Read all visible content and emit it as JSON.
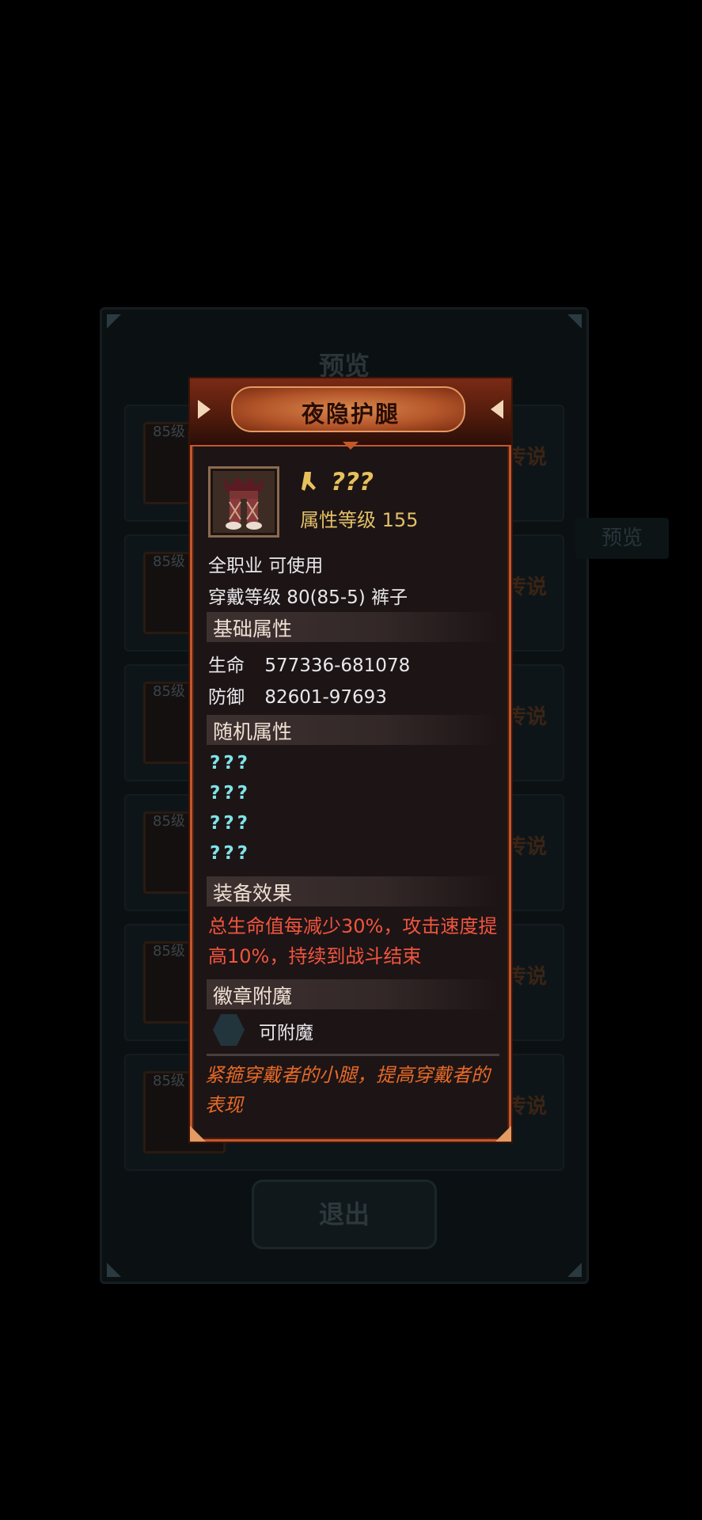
{
  "background": {
    "title": "预览",
    "rows": [
      {
        "level": "85级",
        "tag": "传说"
      },
      {
        "level": "85级",
        "tag": "传说"
      },
      {
        "level": "85级",
        "tag": "传说"
      },
      {
        "level": "85级",
        "tag": "传说"
      },
      {
        "level": "85级",
        "tag": "传说"
      },
      {
        "level": "85级",
        "tag": "传说"
      }
    ],
    "preview_button": "预览",
    "exit_button": "退出"
  },
  "item": {
    "title": "夜隐护腿",
    "name": "???",
    "attr_level": "属性等级 155",
    "class_req": "全职业 可使用",
    "wear_req": "穿戴等级 80(85-5) 裤子",
    "sections": {
      "base": "基础属性",
      "random": "随机属性",
      "effect": "装备效果",
      "badge": "徽章附魔"
    },
    "base_stats": [
      {
        "name": "生命",
        "value": "577336-681078"
      },
      {
        "name": "防御",
        "value": "82601-97693"
      }
    ],
    "random_stats": [
      "???",
      "???",
      "???",
      "???"
    ],
    "effect_text": "总生命值每减少30%，攻击速度提高10%，持续到战斗结束",
    "enchant_label": "可附魔",
    "description": "紧箍穿戴者的小腿，提高穿戴者的表现"
  },
  "colors": {
    "title_text": "#2a0d05",
    "name_gold": "#e6c15c",
    "random_cyan": "#7fe3e8",
    "effect_red": "#f0553f",
    "desc_orange": "#e56a28",
    "frame_orange": "#c2582c"
  }
}
